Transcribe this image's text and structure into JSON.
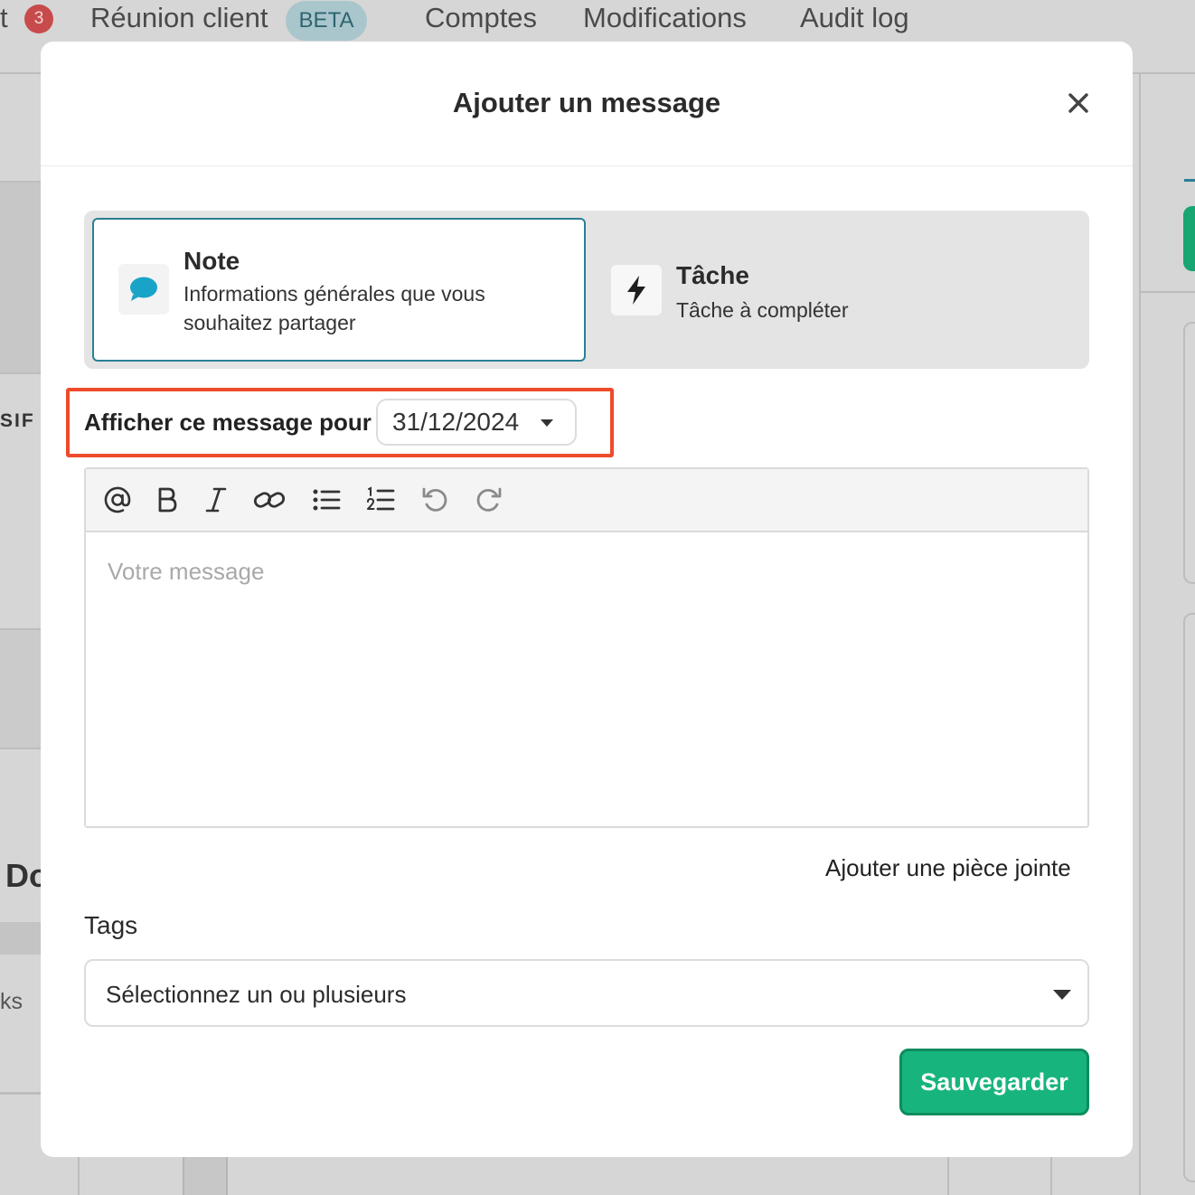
{
  "background": {
    "nav": {
      "partial_tab_letter": "t",
      "badge_count": "3",
      "tab_meeting": "Réunion client",
      "beta_label": "BETA",
      "tab_accounts": "Comptes",
      "tab_changes": "Modifications",
      "tab_audit": "Audit log"
    },
    "fragments": {
      "side_text_1": "SIF",
      "side_text_2": "Do",
      "side_text_3": "ks"
    }
  },
  "modal": {
    "title": "Ajouter un message",
    "close_icon": "close-icon",
    "types": [
      {
        "title": "Note",
        "description": "Informations générales que vous souhaitez partager",
        "icon": "chat-bubble-icon",
        "icon_color": "#1aa3c8",
        "selected": true
      },
      {
        "title": "Tâche",
        "description": "Tâche à compléter",
        "icon": "lightning-icon",
        "icon_color": "#1e1e1e",
        "selected": false
      }
    ],
    "display_for": {
      "label": "Afficher ce message pour",
      "value": "31/12/2024"
    },
    "editor": {
      "toolbar": [
        "mention-icon",
        "bold-icon",
        "italic-icon",
        "link-icon",
        "bullet-list-icon",
        "numbered-list-icon",
        "undo-icon",
        "redo-icon"
      ],
      "placeholder": "Votre message",
      "value": ""
    },
    "attach_label": "Ajouter une pièce jointe",
    "tags": {
      "label": "Tags",
      "placeholder": "Sélectionnez un ou plusieurs"
    },
    "save_label": "Sauvegarder"
  },
  "colors": {
    "accent_border": "#2a7f96",
    "highlight": "#ee4b2b",
    "save_button": "#17b57d",
    "badge": "#c84b4b"
  }
}
